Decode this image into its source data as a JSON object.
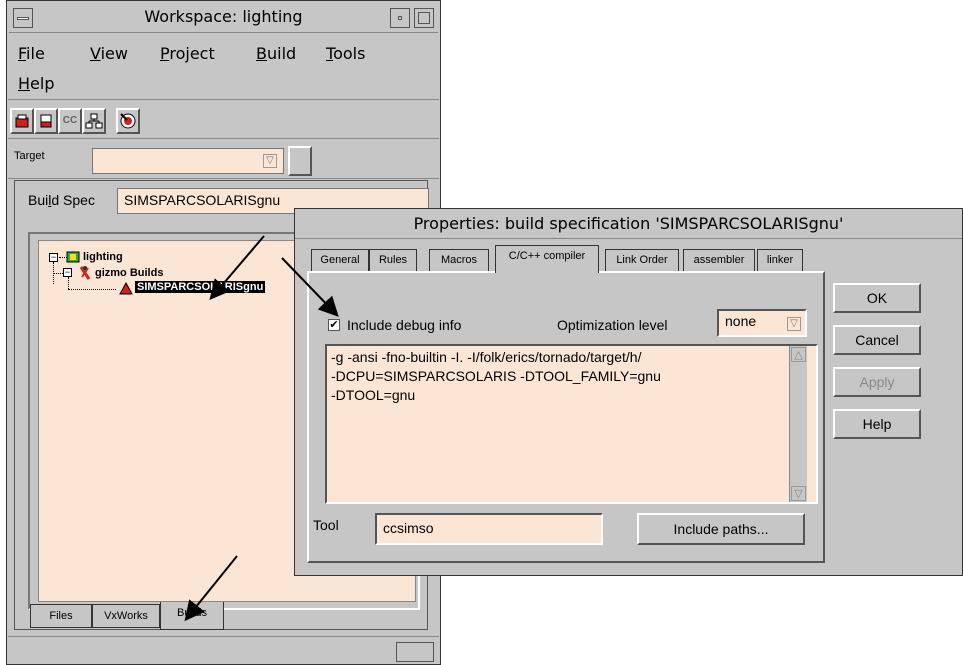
{
  "workspace": {
    "title": "Workspace: lighting",
    "menu": [
      {
        "pre": "",
        "u": "F",
        "post": "ile"
      },
      {
        "pre": "",
        "u": "V",
        "post": "iew"
      },
      {
        "pre": "",
        "u": "P",
        "post": "roject"
      },
      {
        "pre": "",
        "u": "B",
        "post": "uild"
      },
      {
        "pre": "",
        "u": "T",
        "post": "ools"
      },
      {
        "pre": "",
        "u": "H",
        "post": "elp"
      }
    ],
    "toolbar_cc_label": "CC",
    "target_label": "Target",
    "target_value": "",
    "build_spec_label_pre": "Bui",
    "build_spec_label_u": "l",
    "build_spec_label_post": "d Spec",
    "build_spec_value": "SIMSPARCSOLARISgnu",
    "tree": {
      "root": "lighting",
      "child": "gizmo Builds",
      "leaf": "SIMSPARCSOLARISgnu"
    },
    "bottom_tabs": [
      "Files",
      "VxWorks",
      "Builds"
    ]
  },
  "properties": {
    "title": "Properties: build specification 'SIMSPARCSOLARISgnu'",
    "tabs": [
      "General",
      "Rules",
      "Macros",
      "C/C++ compiler",
      "Link Order",
      "assembler",
      "linker"
    ],
    "active_tab": "C/C++ compiler",
    "include_debug_label": "Include debug info",
    "include_debug_checked": true,
    "optimization_label": "Optimization level",
    "optimization_value": "none",
    "flags_lines": [
      "-g -ansi -fno-builtin -I. -I/folk/erics/tornado/target/h/",
      "-DCPU=SIMSPARCSOLARIS -DTOOL_FAMILY=gnu",
      "-DTOOL=gnu"
    ],
    "tool_label": "Tool",
    "tool_value": "ccsimso",
    "include_paths_button": "Include paths...",
    "buttons": {
      "ok": "OK",
      "cancel": "Cancel",
      "apply": "Apply",
      "help": "Help"
    }
  }
}
